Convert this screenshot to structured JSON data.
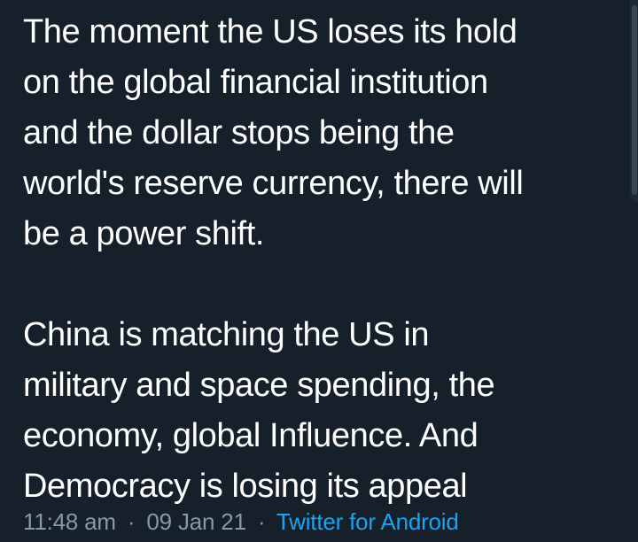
{
  "tweet": {
    "paragraph_1": "The moment the US loses its hold\non the global financial institution\nand the dollar stops being the\nworld's reserve currency, there will\nbe a power shift.",
    "paragraph_2": "China is matching the US in\nmilitary and space spending, the\neconomy, global Influence. And\nDemocracy is losing its appeal"
  },
  "meta": {
    "time": "11:48 am",
    "separator_1": "·",
    "date": "09 Jan 21",
    "separator_2": "·",
    "source": "Twitter for Android"
  },
  "colors": {
    "background": "#15202b",
    "text": "#ffffff",
    "meta_text": "#8899a6",
    "link": "#1da1f2"
  }
}
